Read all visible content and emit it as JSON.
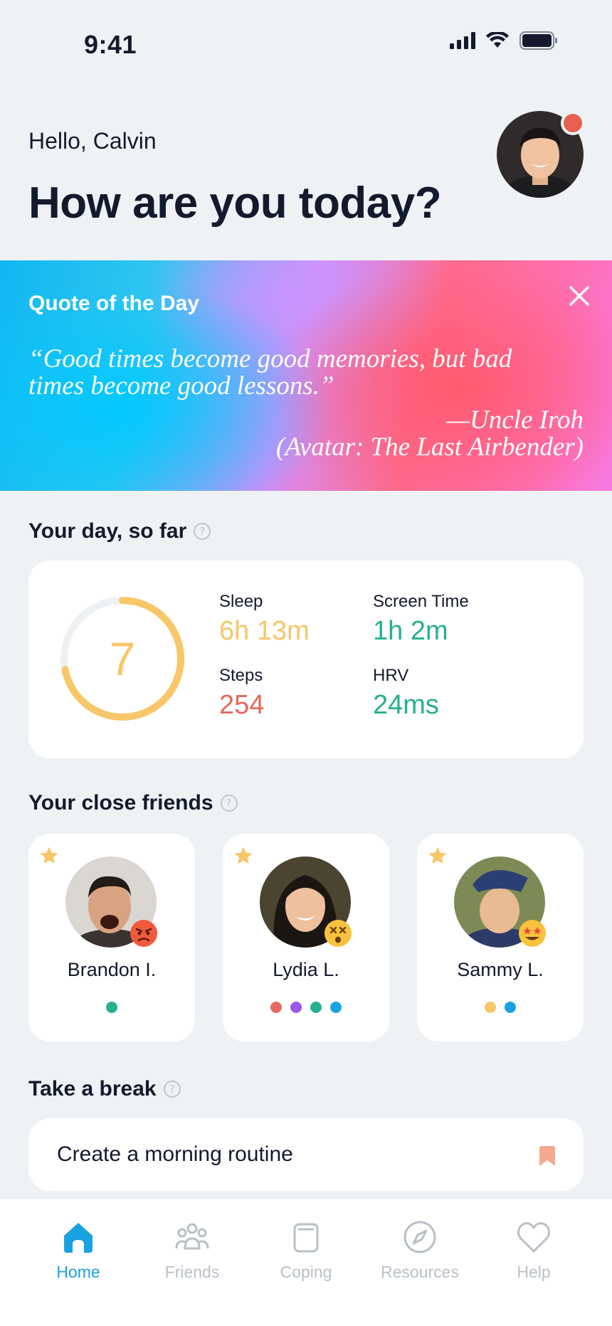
{
  "status_bar": {
    "time": "9:41"
  },
  "header": {
    "greeting": "Hello, Calvin",
    "headline": "How are you today?"
  },
  "quote": {
    "title": "Quote of the Day",
    "line1": "“Good times become good memories, but bad",
    "line2": "times become good lessons.”",
    "author": "—Uncle Iroh",
    "source": "(Avatar: The Last Airbender)"
  },
  "day": {
    "title": "Your day, so far",
    "score": "7",
    "score_fraction": 0.72,
    "metrics": [
      {
        "label": "Sleep",
        "value": "6h 13m",
        "color": "#f7c76a"
      },
      {
        "label": "Screen Time",
        "value": "1h 2m",
        "color": "#27b08f"
      },
      {
        "label": "Steps",
        "value": "254",
        "color": "#e36a5e"
      },
      {
        "label": "HRV",
        "value": "24ms",
        "color": "#27b08f"
      }
    ]
  },
  "friends": {
    "title": "Your close friends",
    "items": [
      {
        "name": "Brandon I.",
        "emoji": "angry-face",
        "dots": [
          "#27b08f"
        ]
      },
      {
        "name": "Lydia L.",
        "emoji": "dizzy-face",
        "dots": [
          "#e36a5e",
          "#9b59e6",
          "#27b08f",
          "#1aa2e0"
        ]
      },
      {
        "name": "Sammy L.",
        "emoji": "star-struck-face",
        "dots": [
          "#f7c76a",
          "#1aa2e0"
        ]
      }
    ]
  },
  "break": {
    "title": "Take a break",
    "item": "Create a morning routine"
  },
  "tabs": [
    {
      "label": "Home",
      "icon": "home-icon",
      "active": true
    },
    {
      "label": "Friends",
      "icon": "friends-icon",
      "active": false
    },
    {
      "label": "Coping",
      "icon": "coping-icon",
      "active": false
    },
    {
      "label": "Resources",
      "icon": "compass-icon",
      "active": false
    },
    {
      "label": "Help",
      "icon": "heart-icon",
      "active": false
    }
  ]
}
